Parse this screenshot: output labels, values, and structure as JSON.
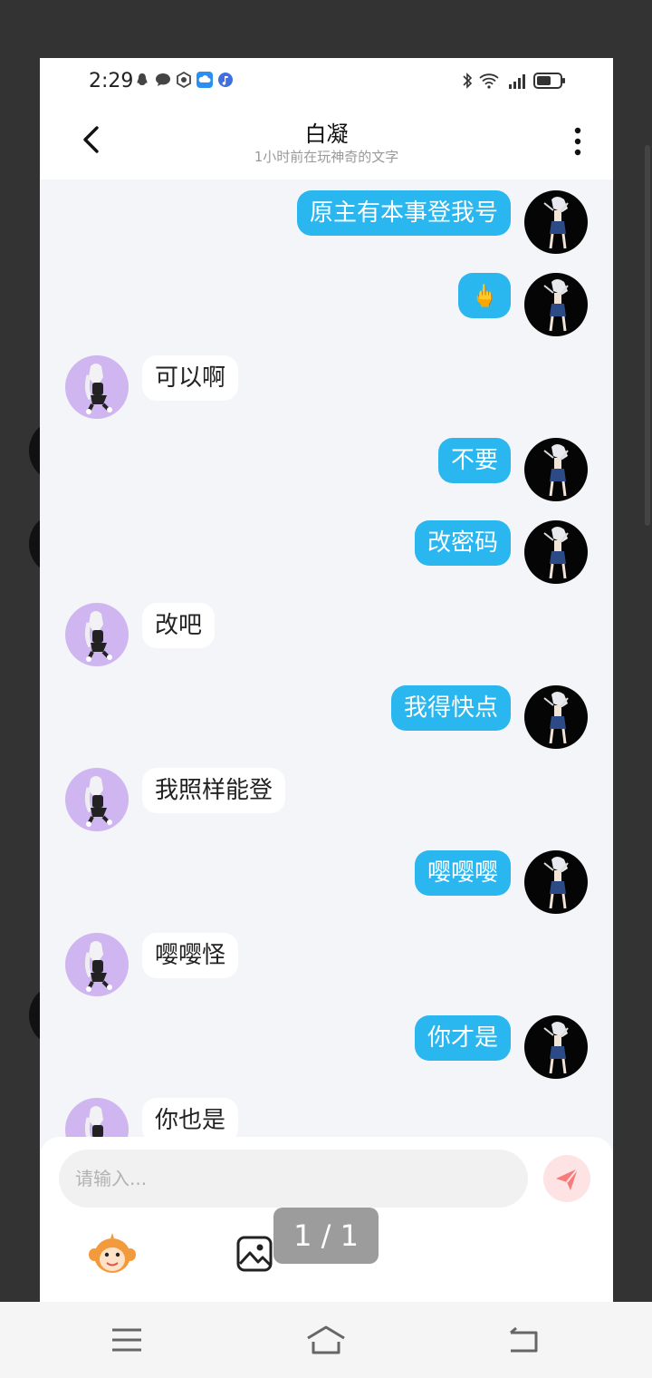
{
  "status_bar": {
    "time": "2:29"
  },
  "header": {
    "title": "白凝",
    "subtitle": "1小时前在玩神奇的文字"
  },
  "messages": [
    {
      "side": "out",
      "text": "原主有本事登我号"
    },
    {
      "side": "out",
      "text": "🖕"
    },
    {
      "side": "in",
      "text": "可以啊"
    },
    {
      "side": "out",
      "text": "不要"
    },
    {
      "side": "out",
      "text": "改密码"
    },
    {
      "side": "in",
      "text": "改吧"
    },
    {
      "side": "out",
      "text": "我得快点"
    },
    {
      "side": "in",
      "text": "我照样能登"
    },
    {
      "side": "out",
      "text": "嘤嘤嘤"
    },
    {
      "side": "in",
      "text": "嘤嘤怪"
    },
    {
      "side": "out",
      "text": "你才是"
    },
    {
      "side": "in",
      "text": "你也是"
    }
  ],
  "input": {
    "placeholder": "请输入..."
  },
  "page_indicator": "1 / 1",
  "colors": {
    "outgoing_bubble": "#2ab7f0",
    "incoming_bubble": "#ffffff",
    "background": "#f3f5f8",
    "send_button": "#f77b7b"
  },
  "icons": {
    "back": "chevron-left-icon",
    "more": "more-vertical-icon",
    "emoji": "monkey-emoji-icon",
    "image": "image-icon",
    "send": "send-icon"
  }
}
